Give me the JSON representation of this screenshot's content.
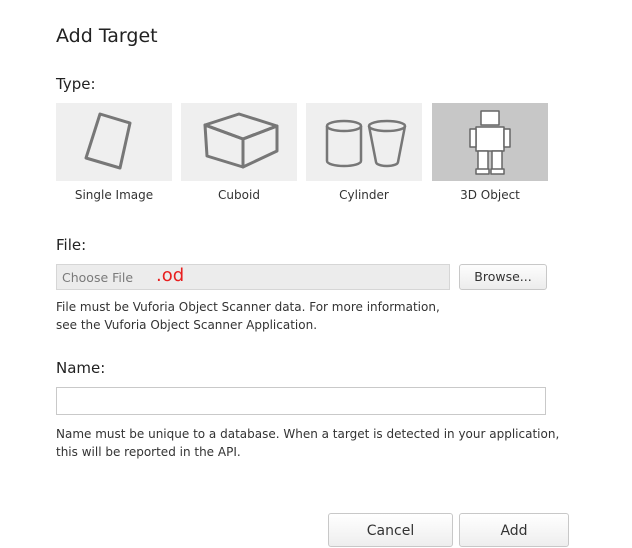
{
  "dialog": {
    "title": "Add Target"
  },
  "type_section": {
    "label": "Type:",
    "options": [
      {
        "label": "Single Image",
        "icon": "single-image-icon",
        "selected": false
      },
      {
        "label": "Cuboid",
        "icon": "cuboid-icon",
        "selected": false
      },
      {
        "label": "Cylinder",
        "icon": "cylinder-icon",
        "selected": false
      },
      {
        "label": "3D Object",
        "icon": "3d-object-icon",
        "selected": true
      }
    ]
  },
  "file_section": {
    "label": "File:",
    "placeholder": "Choose File",
    "extension_hint": ".od",
    "browse_label": "Browse...",
    "help_line1": "File must be Vuforia Object Scanner data. For more information,",
    "help_line2": "see the Vuforia Object Scanner Application."
  },
  "name_section": {
    "label": "Name:",
    "value": "",
    "help_line1": "Name must be unique to a database. When a target is detected in your application,",
    "help_line2": "this will be reported in the API."
  },
  "actions": {
    "cancel_label": "Cancel",
    "add_label": "Add"
  },
  "colors": {
    "selected_tile": "#c7c7c7",
    "tile": "#efefef",
    "extension_hint": "#e81f1f"
  }
}
